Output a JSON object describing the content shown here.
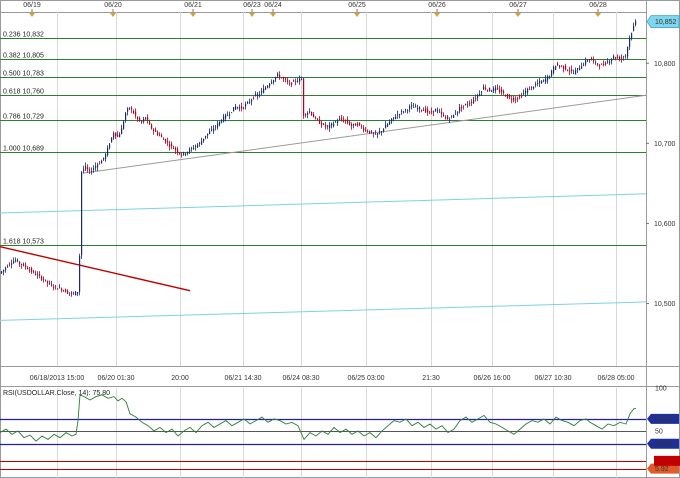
{
  "chart_data": [
    {
      "type": "candlestick",
      "series_name": "USDOLLAR",
      "top_date_labels": [
        "06/19",
        "06/20",
        "06/21",
        "06/23",
        "06/24",
        "06/25",
        "06/26",
        "06/27",
        "06/28"
      ],
      "x_tick_labels": [
        "06/18/2013 15:00",
        "06/20 01:30",
        "20:00",
        "06/21 14:30",
        "06/24 08:30",
        "06/25 03:00",
        "21:30",
        "06/26 16:00",
        "06/27 10:30",
        "06/28 05:00"
      ],
      "y_ticks": [
        10500,
        10600,
        10700,
        10800
      ],
      "y_tick_labels": [
        "10,500",
        "10,600",
        "10,700",
        "10,800"
      ],
      "ylim": [
        10422,
        10864
      ],
      "last_price": 10852,
      "last_price_label": "10,852",
      "fib_levels": [
        {
          "label": "0.236 10,832",
          "value": 10832
        },
        {
          "label": "0.382 10,805",
          "value": 10805
        },
        {
          "label": "0.500 10,783",
          "value": 10783
        },
        {
          "label": "0.618 10,760",
          "value": 10760
        },
        {
          "label": "0.786 10,729",
          "value": 10729
        },
        {
          "label": "1.000 10,689",
          "value": 10689
        },
        {
          "label": "1.618 10,573",
          "value": 10573
        }
      ],
      "price_path": [
        [
          0,
          10538
        ],
        [
          4,
          10542
        ],
        [
          8,
          10548
        ],
        [
          12,
          10552
        ],
        [
          16,
          10554
        ],
        [
          20,
          10550
        ],
        [
          26,
          10546
        ],
        [
          32,
          10540
        ],
        [
          38,
          10535
        ],
        [
          44,
          10530
        ],
        [
          50,
          10524
        ],
        [
          56,
          10520
        ],
        [
          62,
          10518
        ],
        [
          68,
          10514
        ],
        [
          74,
          10512
        ],
        [
          78,
          10515
        ],
        [
          80,
          10560
        ],
        [
          82,
          10665
        ],
        [
          86,
          10670
        ],
        [
          90,
          10664
        ],
        [
          96,
          10672
        ],
        [
          102,
          10678
        ],
        [
          106,
          10686
        ],
        [
          110,
          10700
        ],
        [
          114,
          10714
        ],
        [
          118,
          10708
        ],
        [
          122,
          10718
        ],
        [
          126,
          10738
        ],
        [
          130,
          10745
        ],
        [
          134,
          10738
        ],
        [
          138,
          10730
        ],
        [
          142,
          10726
        ],
        [
          146,
          10733
        ],
        [
          150,
          10722
        ],
        [
          154,
          10716
        ],
        [
          158,
          10712
        ],
        [
          164,
          10705
        ],
        [
          170,
          10698
        ],
        [
          176,
          10692
        ],
        [
          182,
          10686
        ],
        [
          188,
          10690
        ],
        [
          194,
          10695
        ],
        [
          200,
          10700
        ],
        [
          206,
          10710
        ],
        [
          212,
          10716
        ],
        [
          218,
          10724
        ],
        [
          224,
          10732
        ],
        [
          230,
          10738
        ],
        [
          236,
          10746
        ],
        [
          242,
          10744
        ],
        [
          248,
          10750
        ],
        [
          254,
          10758
        ],
        [
          260,
          10762
        ],
        [
          266,
          10770
        ],
        [
          272,
          10778
        ],
        [
          278,
          10785
        ],
        [
          284,
          10780
        ],
        [
          290,
          10774
        ],
        [
          296,
          10778
        ],
        [
          302,
          10780
        ],
        [
          304,
          10736
        ],
        [
          310,
          10740
        ],
        [
          316,
          10730
        ],
        [
          322,
          10724
        ],
        [
          328,
          10720
        ],
        [
          334,
          10725
        ],
        [
          340,
          10730
        ],
        [
          346,
          10728
        ],
        [
          352,
          10722
        ],
        [
          358,
          10724
        ],
        [
          364,
          10718
        ],
        [
          370,
          10714
        ],
        [
          376,
          10710
        ],
        [
          382,
          10716
        ],
        [
          388,
          10724
        ],
        [
          394,
          10732
        ],
        [
          400,
          10738
        ],
        [
          406,
          10742
        ],
        [
          412,
          10746
        ],
        [
          418,
          10744
        ],
        [
          424,
          10742
        ],
        [
          430,
          10738
        ],
        [
          436,
          10742
        ],
        [
          442,
          10736
        ],
        [
          448,
          10730
        ],
        [
          454,
          10735
        ],
        [
          460,
          10744
        ],
        [
          466,
          10748
        ],
        [
          472,
          10752
        ],
        [
          478,
          10760
        ],
        [
          484,
          10770
        ],
        [
          490,
          10766
        ],
        [
          496,
          10768
        ],
        [
          502,
          10764
        ],
        [
          508,
          10758
        ],
        [
          514,
          10755
        ],
        [
          520,
          10758
        ],
        [
          526,
          10765
        ],
        [
          532,
          10770
        ],
        [
          538,
          10775
        ],
        [
          544,
          10778
        ],
        [
          550,
          10785
        ],
        [
          556,
          10798
        ],
        [
          562,
          10796
        ],
        [
          568,
          10792
        ],
        [
          574,
          10788
        ],
        [
          580,
          10795
        ],
        [
          586,
          10802
        ],
        [
          590,
          10806
        ],
        [
          596,
          10800
        ],
        [
          602,
          10797
        ],
        [
          608,
          10802
        ],
        [
          614,
          10808
        ],
        [
          620,
          10806
        ],
        [
          626,
          10810
        ],
        [
          630,
          10832
        ],
        [
          634,
          10846
        ],
        [
          636,
          10852
        ]
      ],
      "trendlines": [
        {
          "color": "#c00000",
          "points": [
            [
              0,
              10571
            ],
            [
              190,
              10516
            ]
          ]
        },
        {
          "color": "#9a9a9a",
          "points": [
            [
              84,
              10663
            ],
            [
              646,
              10760
            ]
          ]
        },
        {
          "color": "#7fd2df",
          "points": [
            [
              0,
              10613
            ],
            [
              646,
              10637
            ]
          ]
        },
        {
          "color": "#7fd2df",
          "points": [
            [
              0,
              10479
            ],
            [
              646,
              10502
            ]
          ]
        }
      ]
    },
    {
      "type": "line",
      "title": "RSI(USDOLLAR.Close, 14): 75.80",
      "ylim": [
        -5,
        100
      ],
      "y_tick_labels": [
        "100",
        "64.00",
        "50",
        "35.00",
        "5.92"
      ],
      "levels": [
        {
          "label": "64.00",
          "value": 64,
          "color": "#2020a0"
        },
        {
          "label": "35.00",
          "value": 35,
          "color": "#2020a0"
        },
        {
          "label": "",
          "value": 50,
          "color": "#555555"
        },
        {
          "label": "",
          "value": 15,
          "color": "#c00000"
        },
        {
          "label": "5.92",
          "value": 5.92,
          "color": "#c00000"
        }
      ],
      "values": [
        [
          0,
          48
        ],
        [
          6,
          52
        ],
        [
          12,
          46
        ],
        [
          18,
          50
        ],
        [
          24,
          42
        ],
        [
          30,
          45
        ],
        [
          36,
          38
        ],
        [
          42,
          44
        ],
        [
          48,
          40
        ],
        [
          54,
          46
        ],
        [
          60,
          42
        ],
        [
          66,
          48
        ],
        [
          72,
          44
        ],
        [
          76,
          46
        ],
        [
          78,
          62
        ],
        [
          80,
          92
        ],
        [
          84,
          90
        ],
        [
          90,
          86
        ],
        [
          96,
          90
        ],
        [
          102,
          92
        ],
        [
          108,
          88
        ],
        [
          114,
          90
        ],
        [
          118,
          85
        ],
        [
          122,
          88
        ],
        [
          126,
          84
        ],
        [
          130,
          70
        ],
        [
          136,
          66
        ],
        [
          142,
          60
        ],
        [
          148,
          56
        ],
        [
          154,
          50
        ],
        [
          160,
          54
        ],
        [
          166,
          48
        ],
        [
          172,
          52
        ],
        [
          178,
          44
        ],
        [
          184,
          50
        ],
        [
          190,
          54
        ],
        [
          196,
          48
        ],
        [
          202,
          56
        ],
        [
          208,
          60
        ],
        [
          214,
          54
        ],
        [
          220,
          58
        ],
        [
          226,
          62
        ],
        [
          232,
          56
        ],
        [
          238,
          60
        ],
        [
          244,
          64
        ],
        [
          250,
          58
        ],
        [
          256,
          62
        ],
        [
          262,
          66
        ],
        [
          268,
          60
        ],
        [
          274,
          64
        ],
        [
          280,
          62
        ],
        [
          286,
          58
        ],
        [
          292,
          60
        ],
        [
          298,
          56
        ],
        [
          304,
          40
        ],
        [
          310,
          48
        ],
        [
          316,
          44
        ],
        [
          322,
          50
        ],
        [
          328,
          46
        ],
        [
          334,
          54
        ],
        [
          340,
          48
        ],
        [
          346,
          52
        ],
        [
          352,
          46
        ],
        [
          358,
          50
        ],
        [
          364,
          44
        ],
        [
          370,
          48
        ],
        [
          376,
          42
        ],
        [
          382,
          50
        ],
        [
          388,
          56
        ],
        [
          394,
          62
        ],
        [
          400,
          60
        ],
        [
          406,
          64
        ],
        [
          412,
          56
        ],
        [
          418,
          60
        ],
        [
          424,
          54
        ],
        [
          430,
          58
        ],
        [
          436,
          52
        ],
        [
          442,
          56
        ],
        [
          448,
          48
        ],
        [
          454,
          52
        ],
        [
          460,
          62
        ],
        [
          466,
          66
        ],
        [
          472,
          60
        ],
        [
          478,
          64
        ],
        [
          484,
          68
        ],
        [
          490,
          60
        ],
        [
          496,
          58
        ],
        [
          502,
          54
        ],
        [
          508,
          50
        ],
        [
          514,
          46
        ],
        [
          520,
          52
        ],
        [
          526,
          58
        ],
        [
          532,
          62
        ],
        [
          538,
          60
        ],
        [
          544,
          64
        ],
        [
          550,
          58
        ],
        [
          556,
          66
        ],
        [
          562,
          62
        ],
        [
          568,
          60
        ],
        [
          574,
          56
        ],
        [
          580,
          62
        ],
        [
          586,
          64
        ],
        [
          590,
          60
        ],
        [
          596,
          56
        ],
        [
          602,
          52
        ],
        [
          608,
          58
        ],
        [
          614,
          56
        ],
        [
          620,
          60
        ],
        [
          626,
          58
        ],
        [
          630,
          70
        ],
        [
          634,
          76
        ],
        [
          636,
          75.8
        ]
      ]
    }
  ]
}
